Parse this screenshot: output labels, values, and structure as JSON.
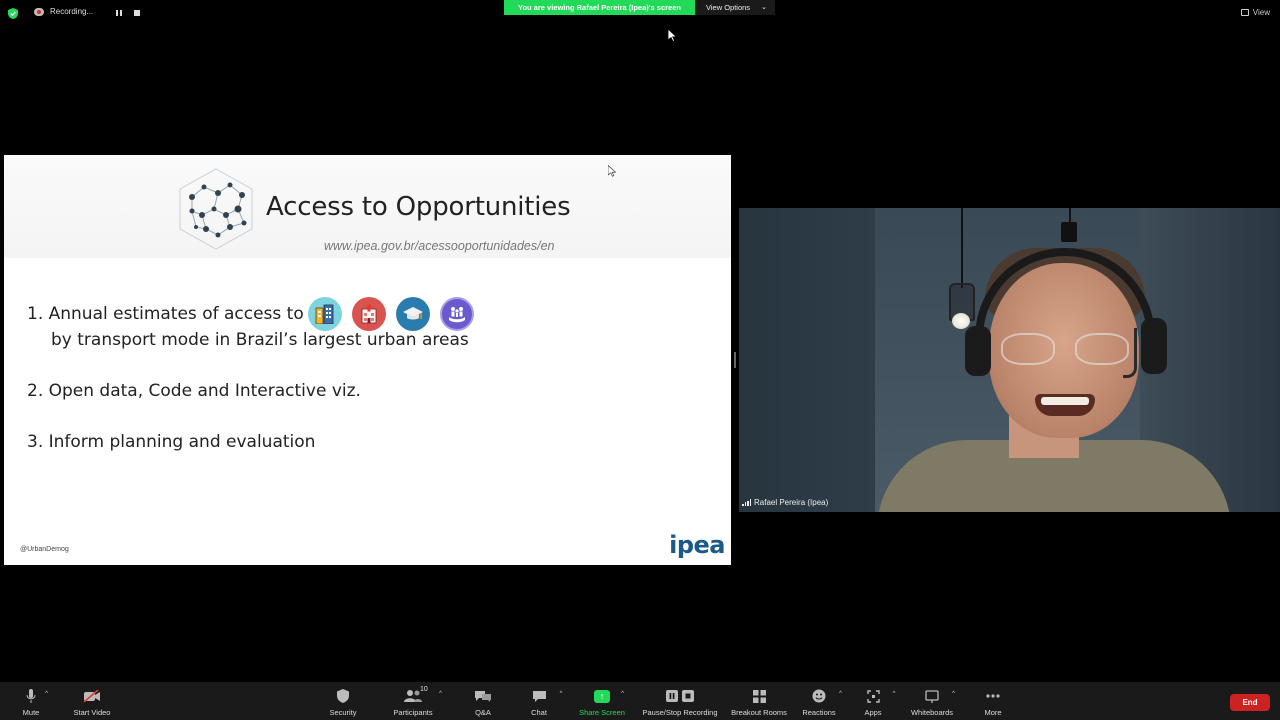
{
  "topbar": {
    "recording_label": "Recording...",
    "viewing_banner": "You are viewing Rafael Pereira (Ipea)'s screen",
    "view_options_label": "View Options",
    "view_label": "View"
  },
  "slide": {
    "title": "Access to Opportunities",
    "url": "www.ipea.gov.br/acessooportunidades/en",
    "items": [
      "1. Annual estimates of access to",
      "by transport mode in Brazil’s largest urban areas",
      "2. Open data, Code and Interactive viz.",
      "3. Inform planning and evaluation"
    ],
    "opportunity_icons": [
      "jobs-icon",
      "health-icon",
      "education-icon",
      "social-assistance-icon"
    ],
    "handle": "@UrbanDemog",
    "logo_text": "ipea"
  },
  "video": {
    "participant_name": "Rafael Pereira (Ipea)"
  },
  "toolbar": {
    "mute": "Mute",
    "start_video": "Start Video",
    "security": "Security",
    "participants": "Participants",
    "participants_count": "10",
    "qa": "Q&A",
    "chat": "Chat",
    "share_screen": "Share Screen",
    "pause_stop_recording": "Pause/Stop Recording",
    "breakout_rooms": "Breakout Rooms",
    "reactions": "Reactions",
    "apps": "Apps",
    "whiteboards": "Whiteboards",
    "more": "More",
    "end": "End"
  },
  "colors": {
    "share_green": "#23d959",
    "end_red": "#cc2222",
    "toolbar_bg": "#1a1a1a",
    "ipea_blue": "#1a5a8a"
  }
}
